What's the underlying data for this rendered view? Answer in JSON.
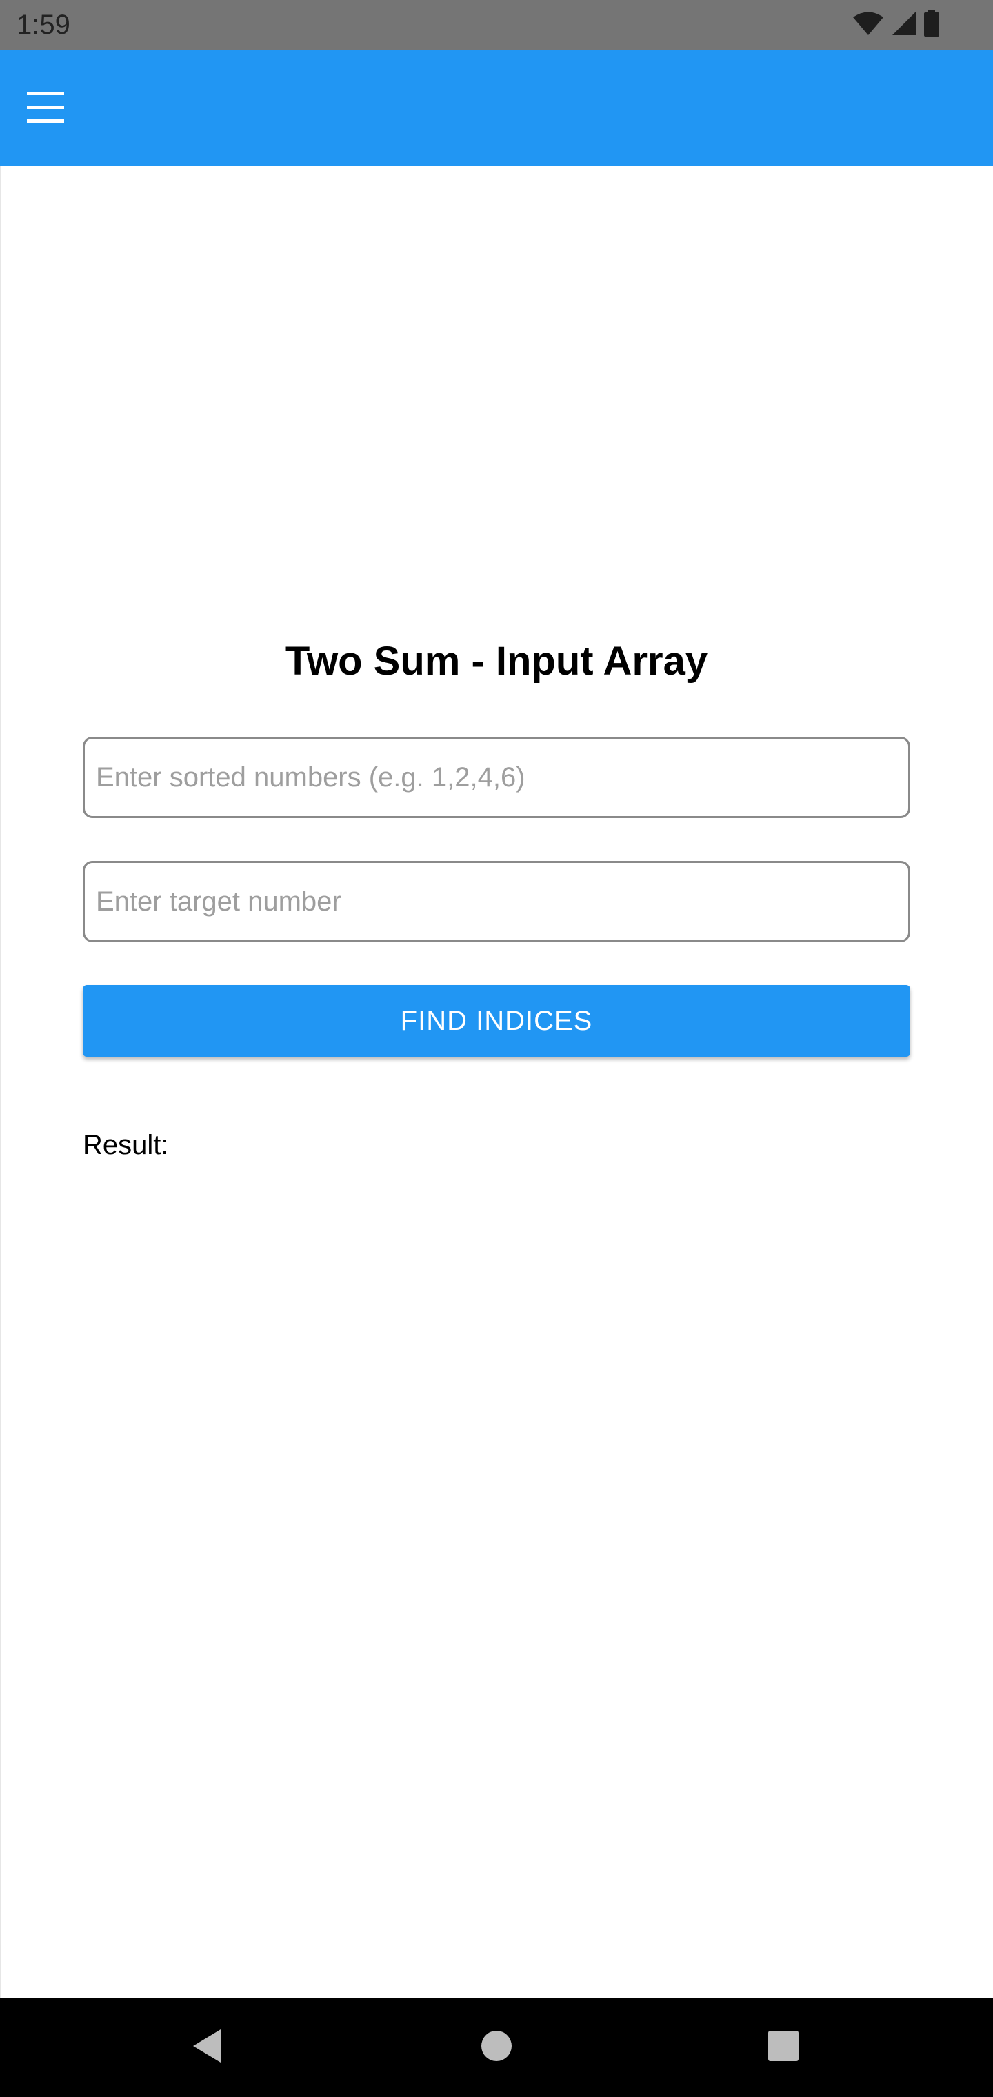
{
  "status_bar": {
    "time": "1:59",
    "icons": [
      "wifi-icon",
      "signal-icon",
      "battery-icon"
    ],
    "background": "#757575"
  },
  "app_bar": {
    "menu_icon": "menu-icon",
    "background": "#2196f3"
  },
  "main": {
    "title": "Two Sum - Input Array",
    "numbers_input": {
      "value": "",
      "placeholder": "Enter sorted numbers (e.g. 1,2,4,6)"
    },
    "target_input": {
      "value": "",
      "placeholder": "Enter target number"
    },
    "find_button_label": "FIND INDICES",
    "result_label": "Result:"
  },
  "nav_bar": {
    "buttons": [
      "back-icon",
      "home-icon",
      "recents-icon"
    ]
  }
}
